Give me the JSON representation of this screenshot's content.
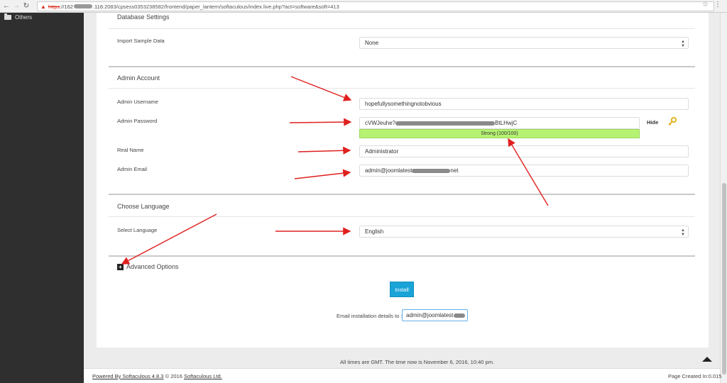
{
  "browser": {
    "url_scheme": "https",
    "url_host_start": "://162",
    "url_host_end": ".116",
    "url_path": ":2083/cpsess0353238582/frontend/paper_lantern/softaculous/index.live.php?act=software&soft=413"
  },
  "sidebar": {
    "items": [
      {
        "label": "Others"
      }
    ]
  },
  "database_settings": {
    "title": "Database Settings",
    "import_sample_label": "Import Sample Data",
    "import_sample_value": "None"
  },
  "admin_account": {
    "title": "Admin Account",
    "username_label": "Admin Username",
    "username_value": "hopefullysomethingnotobvious",
    "password_label": "Admin Password",
    "password_start": "cVWJeuhe?",
    "password_end": "BtLHwjC",
    "strength_text": "Strong (100/100)",
    "hide_label": "Hide",
    "realname_label": "Real Name",
    "realname_value": "Administrator",
    "email_label": "Admin Email",
    "email_start": "admin@joomlatest",
    "email_end": "net"
  },
  "language": {
    "title": "Choose Language",
    "select_label": "Select Language",
    "select_value": "English"
  },
  "advanced": {
    "label": "Advanced Options"
  },
  "install": {
    "button_label": "Install",
    "email_details_label": "Email installation details to :",
    "email_details_value": "admin@joomlatest"
  },
  "footer": {
    "time_note": "All times are GMT. The time now is November 6, 2016, 10:40 pm.",
    "powered_by": "Powered By Softaculous 4.8.3",
    "copyright": "© 2016",
    "company": "Softaculous Ltd.",
    "page_created": "Page Created In:0.015"
  },
  "colors": {
    "accent": "#1aa3d6",
    "strength_bar": "#b6f372",
    "annotation_arrow": "#e02020",
    "sidebar_bg": "#2f2f2f"
  }
}
